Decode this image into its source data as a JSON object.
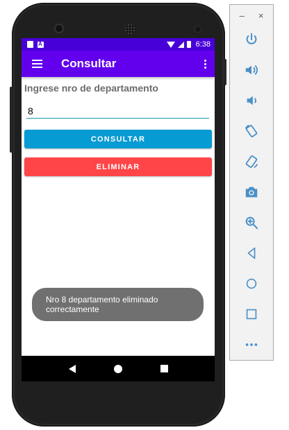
{
  "status_bar": {
    "time": "6:38"
  },
  "app_bar": {
    "title": "Consultar"
  },
  "form": {
    "label": "Ingrese nro de departamento",
    "input_value": "8",
    "consultar_label": "CONSULTAR",
    "eliminar_label": "ELIMINAR"
  },
  "toast": {
    "message": "Nro 8 departamento eliminado correctamente"
  },
  "colors": {
    "status_bar": "#4800d9",
    "app_bar": "#6200ee",
    "consultar_button": "#079bd3",
    "eliminar_button": "#ff4547",
    "input_underline": "#0aa1b0",
    "toast": "#707070"
  },
  "emulator_toolbar": {
    "window_controls": {
      "minimize": "–",
      "close": "×"
    },
    "buttons": [
      "power-icon",
      "volume-up-icon",
      "volume-down-icon",
      "rotate-left-icon",
      "rotate-right-icon",
      "camera-icon",
      "zoom-icon",
      "back-icon",
      "home-icon",
      "overview-icon",
      "more-icon"
    ]
  }
}
